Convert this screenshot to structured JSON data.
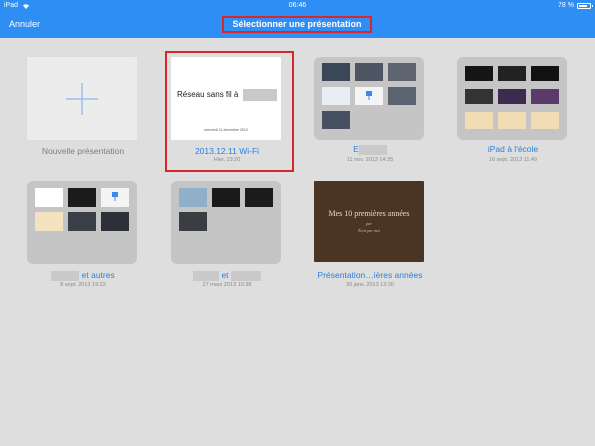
{
  "status": {
    "device": "iPad",
    "time": "06:46",
    "battery": "78 %",
    "battery_level": 0.78
  },
  "nav": {
    "cancel_label": "Annuler",
    "title": "Sélectionner une présentation"
  },
  "presentations": [
    {
      "title": "Nouvelle présentation",
      "date": ""
    },
    {
      "title": "2013.12.11 Wi-Fi",
      "date": "Hier, 13:20",
      "slide_text": "Réseau sans fil à",
      "slide_date": "mercredi 11 décembre 2013"
    },
    {
      "title": "E",
      "date": "11 nov. 2013 14:35"
    },
    {
      "title": "iPad à l'école",
      "date": "16 sept. 2013 11:49"
    },
    {
      "title": "et autres",
      "date": "8 sept. 2013 19:22"
    },
    {
      "title": "et",
      "date": "27 mars 2013 10:38"
    },
    {
      "title": "Présentation…ières années",
      "date": "30 janv. 2013 13:30",
      "cover_title": "Mes 10 premières années",
      "cover_line2": "par",
      "cover_line3": "Écrit par moi"
    }
  ],
  "colors": {
    "accent": "#2f8ef4",
    "highlight": "#d8262b",
    "background": "#dedede"
  }
}
